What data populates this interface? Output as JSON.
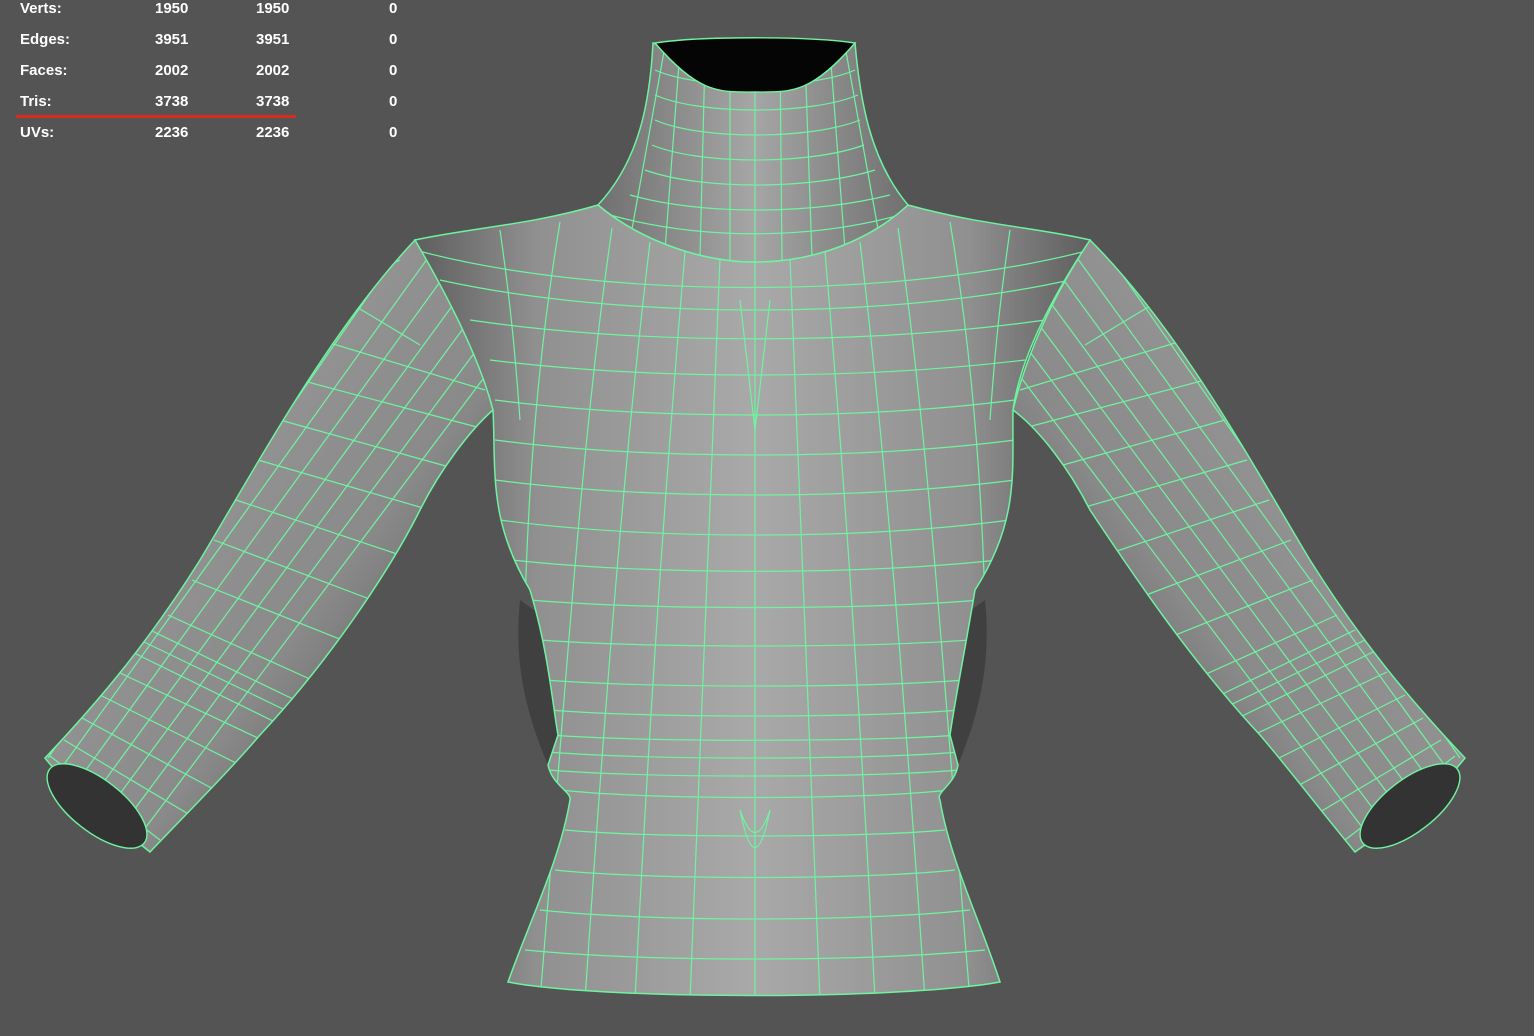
{
  "hud": {
    "rows": [
      {
        "label": "Verts:",
        "v1": "1950",
        "v2": "1950",
        "v3": "0"
      },
      {
        "label": "Edges:",
        "v1": "3951",
        "v2": "3951",
        "v3": "0"
      },
      {
        "label": "Faces:",
        "v1": "2002",
        "v2": "2002",
        "v3": "0"
      },
      {
        "label": "Tris:",
        "v1": "3738",
        "v2": "3738",
        "v3": "0"
      },
      {
        "label": "UVs:",
        "v1": "2236",
        "v2": "2236",
        "v3": "0"
      }
    ]
  },
  "colors": {
    "background": "#545454",
    "wire": "#6ff3a0",
    "shirt_light": "#a9a9a9",
    "shirt_dark": "#5e5e5e",
    "hud_text": "#ffffff",
    "highlight": "#d82c20"
  },
  "icons": [
    "mesh-wireframe"
  ]
}
